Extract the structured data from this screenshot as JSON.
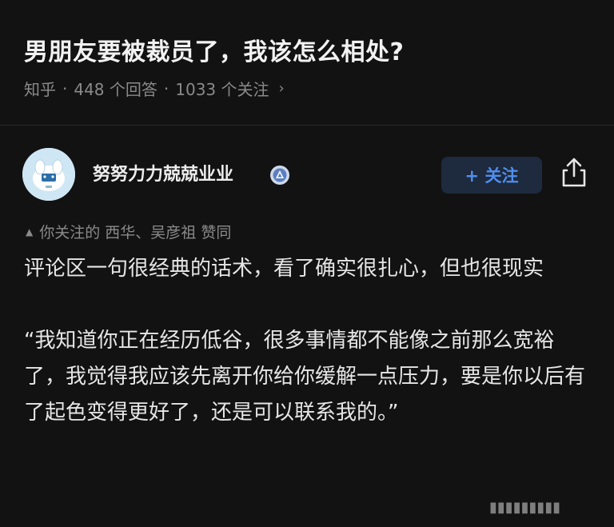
{
  "question": {
    "title": "男朋友要被裁员了，我该怎么相处?",
    "source": "知乎",
    "answers_count": "448 个回答",
    "followers_count": "1033 个关注",
    "separator": "·",
    "chevron": "›"
  },
  "author": {
    "name": "努努力力兢兢业业",
    "avatar_icon": "cartoon-dog-avatar",
    "badge_icon": "verified-badge-icon",
    "follow_label": "+ 关注",
    "share_icon": "share-icon"
  },
  "endorse": {
    "icon": "up-triangle-icon",
    "text": "你关注的 西华、吴彦祖 赞同"
  },
  "answer": {
    "para1": "评论区一句很经典的话术，看了确实很扎心，但也很现实",
    "para2": "“我知道你正在经历低谷，很多事情都不能像之前那么宽裕了，我觉得我应该先离开你给你缓解一点压力，要是你以后有了起色变得更好了，还是可以联系我的。”"
  },
  "watermark": {
    "text": "▮▮▮▮▮▮▮▮▮"
  },
  "colors": {
    "background": "#121212",
    "accent_blue": "#4f8ff0",
    "follow_bg": "#1e2a3d",
    "muted_text": "#8a8a8a"
  }
}
